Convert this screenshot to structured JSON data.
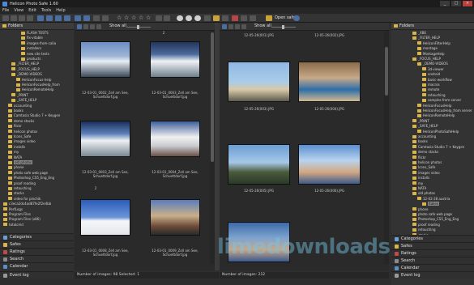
{
  "window": {
    "title": "Helicon Photo Safe 1.60",
    "controls": [
      "_",
      "□",
      "×"
    ]
  },
  "menu": [
    "File",
    "View",
    "Edit",
    "Tools",
    "Help"
  ],
  "toolbar": {
    "show_all_1": "Show all",
    "show_all_2": "Show all",
    "open_safe": "Open safe"
  },
  "left_panel": {
    "header": "Folders",
    "items": [
      "FLASH TESTS",
      "fix-vitable",
      "images-from-calia",
      "installers",
      "new site tests",
      "products",
      "_FILTER_HELP",
      "_FOCUS_HELP",
      "_DEMO-VIDEOS",
      "HeliconFocus-help",
      "HeliconFocusHelp_from",
      "HeliconRemoteHelp",
      "_PRINT",
      "_SAFE_HELP",
      "accounting",
      "books",
      "Camtasia Studio 7 + Keygen",
      "demo stacks",
      "flickr",
      "helicon photos",
      "Icons_Safe",
      "images video",
      "installs",
      "my",
      "NATA",
      "old photos",
      "phone",
      "photo safe web page",
      "Photoshop_CS5_Eng_Eng",
      "proof reading",
      "retouching",
      "stacks",
      "video for pinchik",
      "c3eca2dc4ad87fe2f2e4bb",
      "PerfLogs",
      "Program Files",
      "Program Files (x86)",
      "totalcmd"
    ],
    "selected": "old photos",
    "tabs": [
      "Categories",
      "Safes",
      "Ratings",
      "Search",
      "Calendar",
      "Event log"
    ]
  },
  "viewer_left": {
    "marker_top": "2",
    "marker_mid": "2",
    "items": [
      {
        "caption1": "12-03-01_0002_Zell am See,",
        "caption2": "Schuettdorf.jpg"
      },
      {
        "caption1": "12-03-01_0003_Zell am See,",
        "caption2": "Schuettdorf.jpg"
      },
      {
        "caption1": "12-03-01_0003_Zell am See,",
        "caption2": "Schuettdorf.jpg"
      },
      {
        "caption1": "12-03-01_0004_Zell am See,",
        "caption2": "Schuettdorf.jpg"
      },
      {
        "caption1": "12-03-01_0008_Zell am See,",
        "caption2": "Schuettdorf.jpg"
      },
      {
        "caption1": "12-03-01_0009_Zell am See,",
        "caption2": "Schuettdorf.jpg"
      }
    ],
    "status": "Number of images: 98  Selected: 1"
  },
  "viewer_right": {
    "items": [
      {
        "caption": "12-05-26(001).JPG"
      },
      {
        "caption": "12-05-26(002).JPG"
      },
      {
        "caption": "12-05-26(003).JPG"
      },
      {
        "caption": "12-05-26(004).JPG"
      },
      {
        "caption": "12-05-26(005).JPG"
      },
      {
        "caption": "12-05-26(006).JPG"
      },
      {
        "caption": "12-05-26(007).JPG"
      }
    ],
    "status": "Number of images: 212"
  },
  "right_panel": {
    "header": "Folders",
    "items": [
      "_XBE",
      "_FILTER_HELP",
      "HeliconFilterHelp",
      "montage",
      "MontageHelp",
      "_FOCUS_HELP",
      "_DEMO-VIDEOS",
      "3d-viewer",
      "android",
      "basic-workflow",
      "macros",
      "remote",
      "retouching",
      "samples from server",
      "HeliconFocusHelp",
      "HeliconFocusHelp_from server",
      "HeliconRemoteHelp",
      "_PRINT",
      "_SAFE_HELP",
      "HeliconPhotoSafeHelp",
      "accounting",
      "books",
      "Camtasia Studio 7 + Keygen",
      "demo stacks",
      "flickr",
      "helicon photos",
      "Icons_Safe",
      "images video",
      "installs",
      "my",
      "NATA",
      "old photos",
      "12-02-28 austria",
      "Italien",
      "phone",
      "photo safe web page",
      "Photoshop_CS5_Eng_Eng",
      "proof reading",
      "retouching",
      "stacks"
    ],
    "selected": "Italien",
    "tabs": [
      "Categories",
      "Safes",
      "Ratings",
      "Search",
      "Calendar",
      "Event log"
    ]
  },
  "watermark": "limedownloads",
  "colors": {
    "folder": "#d9b44a",
    "accent": "#4b6ea0"
  }
}
